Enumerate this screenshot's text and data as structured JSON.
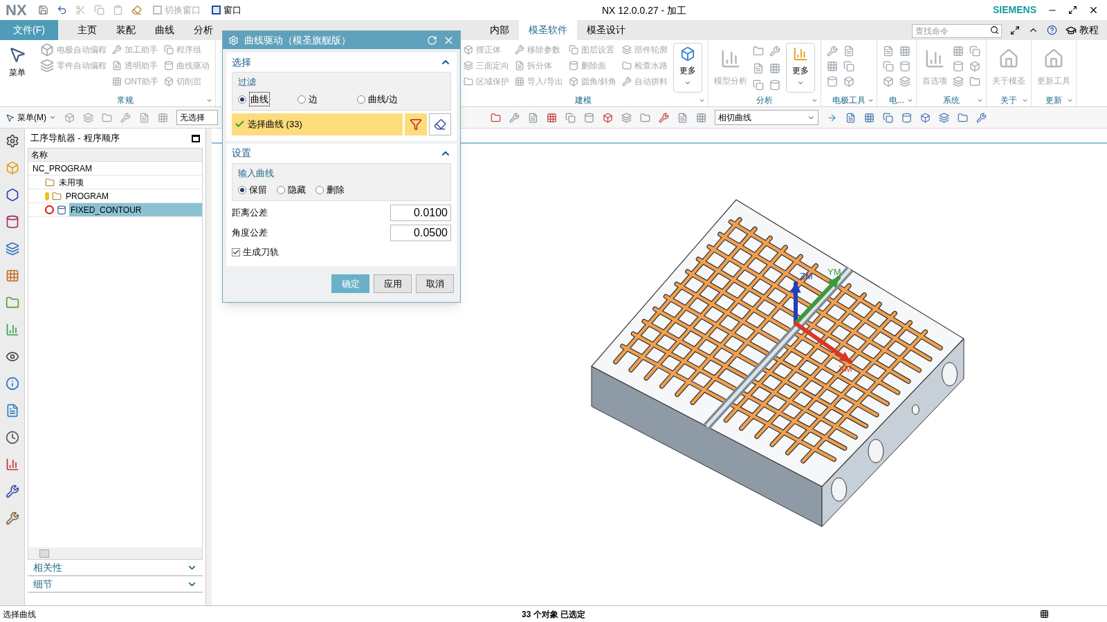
{
  "title_bar": {
    "logo": "NX",
    "quick_access": [
      {
        "label": "切换窗口"
      },
      {
        "label": "窗口"
      }
    ],
    "title": "NX 12.0.0.27 - 加工",
    "brand": "SIEMENS"
  },
  "menu": {
    "file": "文件(F)",
    "tabs": [
      {
        "label": "主页",
        "selected": false
      },
      {
        "label": "装配",
        "selected": false
      },
      {
        "label": "曲线",
        "selected": false
      },
      {
        "label": "分析",
        "selected": false
      },
      {
        "label": "内部",
        "selected": false
      },
      {
        "label": "模圣软件",
        "selected": true
      },
      {
        "label": "模圣设计",
        "selected": false
      }
    ],
    "search": {
      "placeholder": "查找命令"
    },
    "help": "教程"
  },
  "ribbon": {
    "menu_button": "菜单",
    "groups": [
      {
        "kind": "list",
        "label": "常规",
        "columns": [
          [
            "电极自动编程",
            "零件自动编程"
          ],
          [
            "加工助手",
            "透明助手",
            "ONT助手"
          ],
          [
            "程序组",
            "曲线驱动",
            "切削层"
          ]
        ]
      },
      {
        "kind": "list",
        "label": "建模",
        "columns": [
          [
            "摆正体",
            "三面定向",
            "区域保护"
          ],
          [
            "移除参数",
            "拆分体",
            "导入/导出"
          ],
          [
            "图层设置",
            "删除面",
            "圆角/斜角"
          ],
          [
            "部件轮廓",
            "检查水路",
            "自动拼料"
          ]
        ],
        "more": "更多"
      },
      {
        "kind": "tools",
        "label": "分析",
        "big": "模型分析",
        "more": "更多"
      },
      {
        "kind": "icons",
        "label": "电极工具"
      },
      {
        "kind": "icons",
        "label": "电..."
      },
      {
        "kind": "tools",
        "label": "系统",
        "big": "首选项"
      },
      {
        "kind": "big",
        "label": "关于",
        "big": "关于模圣"
      },
      {
        "kind": "big",
        "label": "更新",
        "big": "更新工具"
      }
    ]
  },
  "toolbar": {
    "menu_button": "菜单(M)",
    "selection_filter": "无选择",
    "curve_rule": "相切曲线"
  },
  "navigator": {
    "title": "工序导航器 - 程序顺序",
    "column": "名称",
    "tree": [
      {
        "label": "NC_PROGRAM",
        "selected": false,
        "children": [
          {
            "label": "未用项",
            "kind": "group",
            "selected": false
          },
          {
            "label": "PROGRAM",
            "kind": "program",
            "selected": false
          },
          {
            "label": "FIXED_CONTOUR",
            "kind": "operation",
            "selected": true
          }
        ]
      }
    ],
    "panels": [
      {
        "label": "相关性",
        "expanded": false
      },
      {
        "label": "细节",
        "expanded": false
      }
    ]
  },
  "dialog": {
    "title": "曲线驱动（模圣旗舰版）",
    "sections": [
      {
        "kind": "selection",
        "label": "选择",
        "expanded": true,
        "group_label": "过滤",
        "options": [
          {
            "label": "曲线",
            "selected": true
          },
          {
            "label": "边",
            "selected": false
          },
          {
            "label": "曲线/边",
            "selected": false
          }
        ],
        "select_label": "选择曲线 (33)"
      },
      {
        "kind": "settings",
        "label": "设置",
        "expanded": true,
        "group_label": "输入曲线",
        "options": [
          {
            "label": "保留",
            "selected": true
          },
          {
            "label": "隐藏",
            "selected": false
          },
          {
            "label": "删除",
            "selected": false
          }
        ],
        "fields": [
          {
            "label": "距离公差",
            "value": "0.0100"
          },
          {
            "label": "角度公差",
            "value": "0.0500"
          }
        ],
        "checkbox": {
          "label": "生成刀轨",
          "checked": true
        }
      }
    ],
    "buttons": [
      {
        "label": "确定",
        "kind": "primary"
      },
      {
        "label": "应用",
        "kind": "normal"
      },
      {
        "label": "取消",
        "kind": "normal"
      }
    ]
  },
  "viewport": {
    "axes": [
      {
        "label": "ZM",
        "color": "#1f3fbf"
      },
      {
        "label": "YM",
        "color": "#3a9a3a"
      },
      {
        "label": "XM",
        "color": "#d9362b"
      }
    ]
  },
  "status_bar": {
    "prompt": "选择曲线",
    "message": "33 个对象 已选定"
  }
}
